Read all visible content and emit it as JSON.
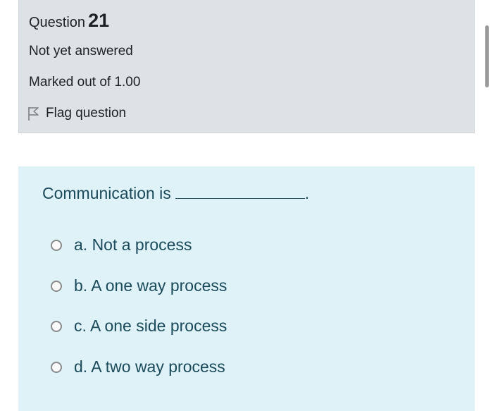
{
  "question_info": {
    "label": "Question",
    "number": "21",
    "state": "Not yet answered",
    "grade": "Marked out of 1.00",
    "flag_label": "Flag question"
  },
  "question": {
    "text": "Communication is",
    "suffix": ".",
    "answers": [
      {
        "prefix": "a.",
        "text": "Not a process",
        "label": "a. Not a process"
      },
      {
        "prefix": "b.",
        "text": "A one way process",
        "label": "b. A one way process"
      },
      {
        "prefix": "c.",
        "text": "A one side process",
        "label": "c. A one side process"
      },
      {
        "prefix": "d.",
        "text": "A two way process",
        "label": "d. A two way process"
      }
    ]
  },
  "icons": {
    "flag": "flag-outline-icon",
    "radio": "radio-unchecked-icon"
  },
  "colors": {
    "info_background": "#dee2e6",
    "question_background": "#def2f8",
    "question_text": "#1b4a5a"
  }
}
